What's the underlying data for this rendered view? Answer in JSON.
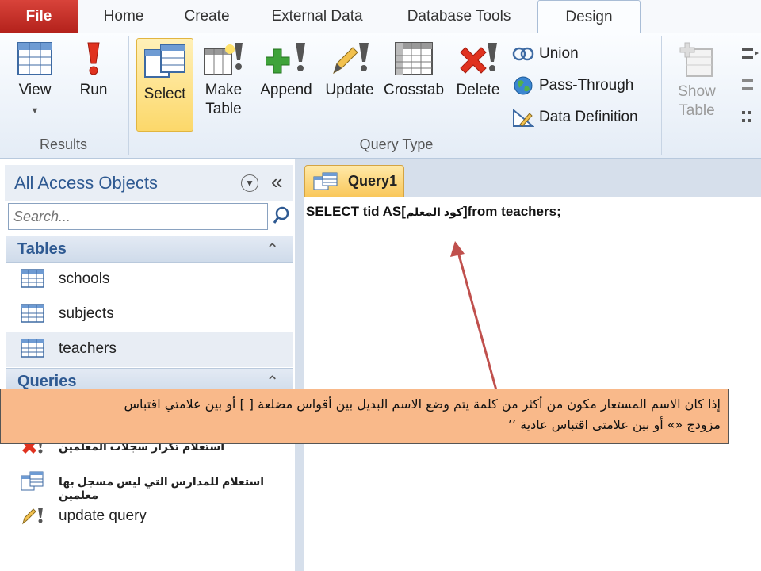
{
  "tabs": {
    "file": "File",
    "home": "Home",
    "create": "Create",
    "external": "External Data",
    "dbtools": "Database Tools",
    "design": "Design"
  },
  "ribbon": {
    "results": {
      "view": "View",
      "run": "Run",
      "label": "Results"
    },
    "query_type": {
      "select": "Select",
      "make_table": "Make Table",
      "append": "Append",
      "update": "Update",
      "crosstab": "Crosstab",
      "delete": "Delete",
      "union": "Union",
      "pass_through": "Pass-Through",
      "data_definition": "Data Definition",
      "label": "Query Type"
    },
    "show_table": "Show Table"
  },
  "nav": {
    "title": "All Access Objects",
    "collapse": "«",
    "search_placeholder": "Search...",
    "tables_title": "Tables",
    "tables": [
      "schools",
      "subjects",
      "teachers"
    ],
    "queries_title": "Queries",
    "queries": [
      "استعلام تكرار سجلات المعلمين",
      "استعلام للمدارس التي ليس مسجل بها معلمين",
      "update query"
    ]
  },
  "doc": {
    "tab_label": "Query1",
    "sql_prefix": "SELECT tid AS[",
    "sql_alias": "كود المعلم",
    "sql_suffix": "]from teachers;"
  },
  "annotation": {
    "line1": "إذا كان الاسم المستعار مكون من أكثر من كلمة يتم وضع الاسم البديل بين أقواس مضلعة [ ] أو بين علامتي اقتباس",
    "line2": "مزودج «» أو بين علامتى اقتباس عادية ٬٬"
  },
  "colors": {
    "file_tab": "#c5302a",
    "accent_blue": "#2f5a92",
    "select_highlight": "#fcd86a",
    "callout_bg": "#f9b98a",
    "arrow": "#c0504d"
  }
}
